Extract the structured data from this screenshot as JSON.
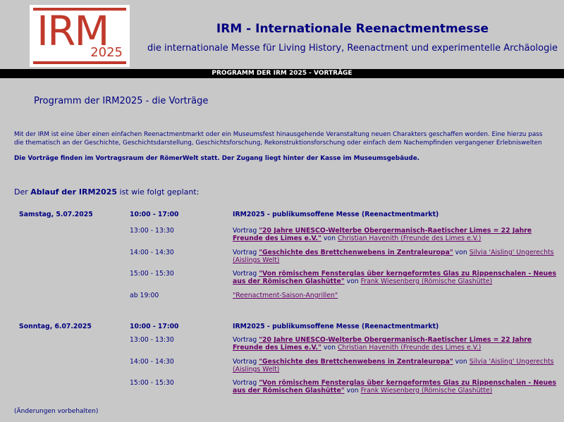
{
  "logo": {
    "text": "IRM",
    "year": "2025"
  },
  "header": {
    "title": "IRM - Internationale Reenactmentmesse",
    "subtitle": "die internationale Messe für Living History, Reenactment und experimentelle Archäologie"
  },
  "nav": {
    "label": "PROGRAMM DER IRM 2025 - VORTRÄGE"
  },
  "page": {
    "heading": "Programm der IRM2025 - die Vorträge",
    "intro_line1": "Mit der IRM ist eine über einen einfachen Reenactmentmarkt oder ein Museumsfest hinausgehende Veranstaltung neuen Charakters geschaffen worden. Eine hierzu pass",
    "intro_line2": "die thematisch an der Geschichte, Geschichtsdarstellung, Geschichtsforschung, Rekonstruktionsforschung oder einfach dem Nachempfinden vergangener Erlebniswelten",
    "note": "Die Vorträge finden im Vortragsraum der RömerWelt statt. Der Zugang liegt hinter der Kasse im Museumsgebäude.",
    "ablauf_pre": "Der ",
    "ablauf_bold": "Ablauf der IRM2025",
    "ablauf_post": " ist wie folgt geplant:",
    "footer": "(Änderungen vorbehalten)"
  },
  "common": {
    "vortrag": "Vortrag",
    "von": "von"
  },
  "days": [
    {
      "day": "Samstag, 5.07.2025",
      "main_time": "10:00 - 17:00",
      "main_event": "IRM2025 - publikumsoffene Messe (Reenactmentmarkt)",
      "talks": [
        {
          "time": "13:00 - 13:30",
          "title": "\"20 Jahre UNESCO-Welterbe Obergermanisch-Raetischer Limes = 22 Jahre Freunde des Limes e.V.\"",
          "person": "Christian Havenith (Freunde des Limes e.V.)"
        },
        {
          "time": "14:00 - 14:30",
          "title": "\"Geschichte des Brettchenwebens in Zentraleuropa\"",
          "person": "Silvia 'Aisling' Ungerechts (Aislings Welt)"
        },
        {
          "time": "15:00 - 15:30",
          "title": "\"Von römischem Fensterglas über kerngeformtes Glas zu Rippenschalen - Neues aus der Römischen Glashütte\"",
          "person": "Frank Wiesenberg (Römische Glashütte)"
        }
      ],
      "evening_time": "ab 19:00",
      "evening_event": "\"Reenactment-Saison-Angrillen\""
    },
    {
      "day": "Sonntag, 6.07.2025",
      "main_time": "10:00 - 17:00",
      "main_event": "IRM2025 - publikumsoffene Messe (Reenactmentmarkt)",
      "talks": [
        {
          "time": "13:00 - 13:30",
          "title": "\"20 Jahre UNESCO-Welterbe Obergermanisch-Raetischer Limes = 22 Jahre Freunde des Limes e.V.\"",
          "person": "Christian Havenith (Freunde des Limes e.V.)"
        },
        {
          "time": "14:00 - 14:30",
          "title": "\"Geschichte des Brettchenwebens in Zentraleuropa\"",
          "person": "Silvia 'Aisling' Ungerechts (Aislings Welt)"
        },
        {
          "time": "15:00 - 15:30",
          "title": "\"Von römischem Fensterglas über kerngeformtes Glas zu Rippenschalen - Neues aus der Römischen Glashütte\"",
          "person": "Frank Wiesenberg (Römische Glashütte)"
        }
      ]
    }
  ]
}
